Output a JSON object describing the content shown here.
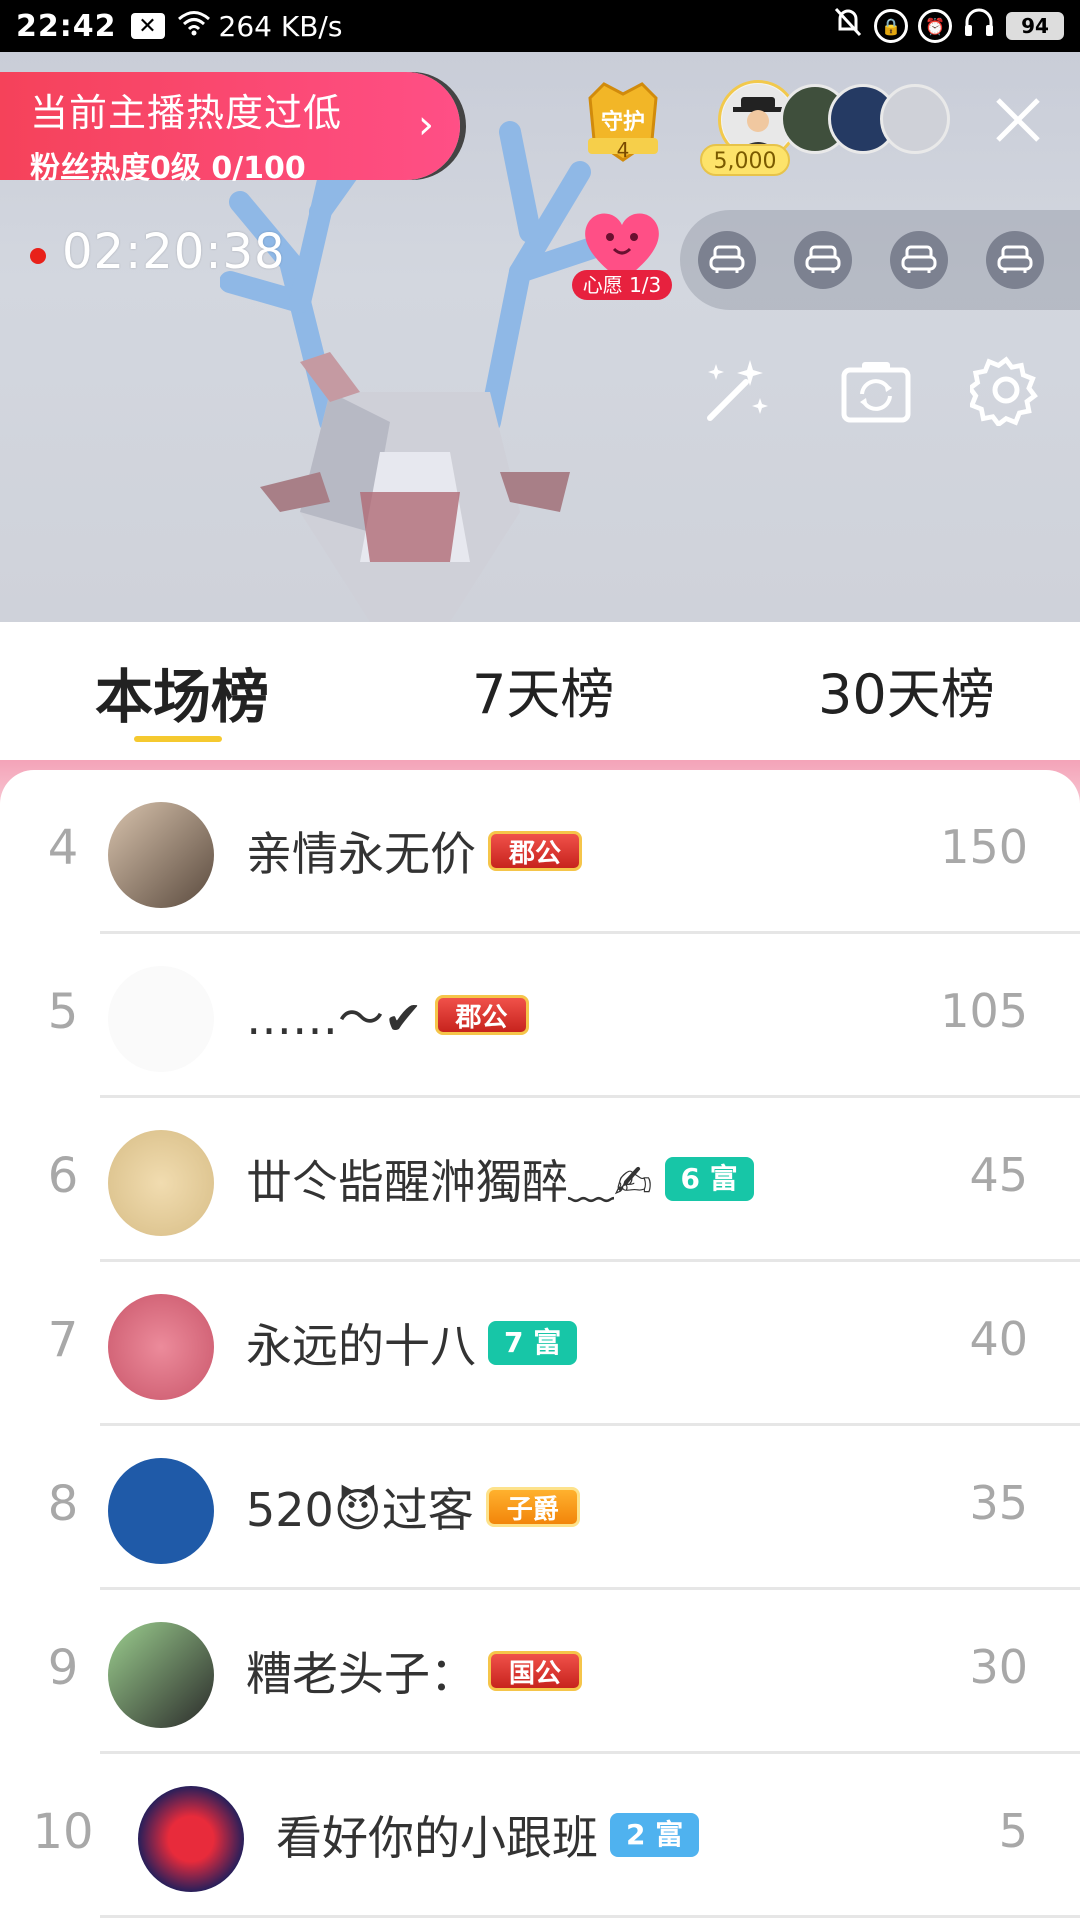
{
  "status_bar": {
    "time": "22:42",
    "notification_icon": "x-box-icon",
    "speed": "264 KB/s",
    "battery": "94"
  },
  "live": {
    "hotness_title": "当前主播热度过低",
    "hotness_sub": "粉丝热度0级 0/100",
    "guard_label": "守护",
    "guard_count": "4",
    "top_audience_score": "5,000",
    "timer": "02:20:38",
    "wish_label": "心愿 1/3",
    "colors": {
      "live_red": "#e8211a",
      "hot_pink": "#ff4f86",
      "gold": "#f5c92f"
    }
  },
  "tabs": [
    {
      "label": "本场榜",
      "active": true
    },
    {
      "label": "7天榜",
      "active": false
    },
    {
      "label": "30天榜",
      "active": false
    }
  ],
  "ranking": [
    {
      "rank": "4",
      "name": "亲情永无价",
      "badge": "郡公",
      "badge_style": "red",
      "score": "150"
    },
    {
      "rank": "5",
      "name": "……〜✔",
      "badge": "郡公",
      "badge_style": "red",
      "score": "105"
    },
    {
      "rank": "6",
      "name": "丗仒啙醒浺獨醉﹏✍",
      "badge": "6 富",
      "badge_style": "teal",
      "score": "45"
    },
    {
      "rank": "7",
      "name": "永远的十八",
      "badge": "7 富",
      "badge_style": "teal",
      "score": "40"
    },
    {
      "rank": "8",
      "name": "520😈过客",
      "badge": "子爵",
      "badge_style": "orange",
      "score": "35"
    },
    {
      "rank": "9",
      "name": "糟老头子：",
      "badge": "国公",
      "badge_style": "red",
      "score": "30"
    },
    {
      "rank": "10",
      "name": "看好你的小跟班",
      "badge": "2 富",
      "badge_style": "blue",
      "score": "5"
    }
  ]
}
